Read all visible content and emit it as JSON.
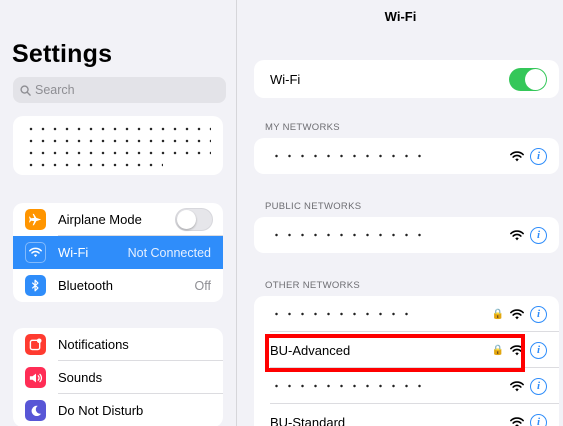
{
  "sidebar": {
    "title": "Settings",
    "search_placeholder": "Search",
    "rows": [
      {
        "label": "Airplane Mode",
        "value": "",
        "icon": "airplane-icon",
        "color": "#ff9500"
      },
      {
        "label": "Wi-Fi",
        "value": "Not Connected",
        "icon": "wifi-icon",
        "color": "#2f8dfa",
        "selected": true
      },
      {
        "label": "Bluetooth",
        "value": "Off",
        "icon": "bluetooth-icon",
        "color": "#2f8dfa"
      },
      {
        "label": "Notifications",
        "value": "",
        "icon": "notifications-icon",
        "color": "#ff3b30"
      },
      {
        "label": "Sounds",
        "value": "",
        "icon": "sounds-icon",
        "color": "#ff2d55"
      },
      {
        "label": "Do Not Disturb",
        "value": "",
        "icon": "moon-icon",
        "color": "#5856d6"
      }
    ]
  },
  "detail": {
    "nav_title": "Wi-Fi",
    "wifi_label": "Wi-Fi",
    "wifi_on": true,
    "sections": {
      "my_networks": "MY NETWORKS",
      "public_networks": "PUBLIC NETWORKS",
      "other_networks": "OTHER NETWORKS"
    },
    "other_networks": [
      {
        "name": "",
        "locked": true
      },
      {
        "name": "BU-Advanced",
        "locked": true
      },
      {
        "name": "",
        "locked": false
      },
      {
        "name": "BU-Standard",
        "locked": false
      }
    ]
  },
  "colors": {
    "accent": "#2f8dfa",
    "toggle_on": "#34c759",
    "highlight": "#ff0000"
  }
}
